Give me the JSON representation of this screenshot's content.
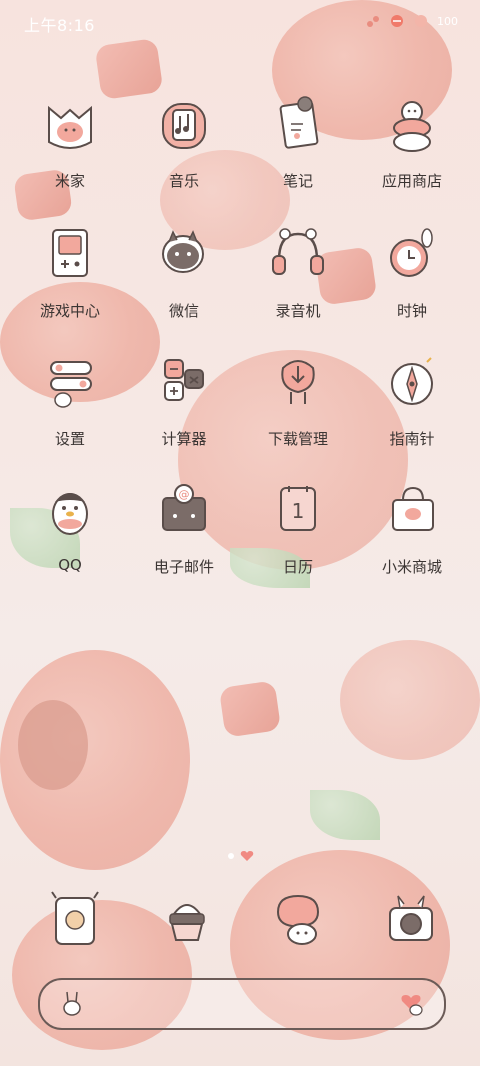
{
  "status_bar": {
    "time": "上午8:16",
    "battery_text": "100"
  },
  "apps": [
    {
      "label": "米家",
      "icon": "mijia-icon"
    },
    {
      "label": "音乐",
      "icon": "music-icon"
    },
    {
      "label": "笔记",
      "icon": "notes-icon"
    },
    {
      "label": "应用商店",
      "icon": "app-store-icon"
    },
    {
      "label": "游戏中心",
      "icon": "game-center-icon"
    },
    {
      "label": "微信",
      "icon": "wechat-icon"
    },
    {
      "label": "录音机",
      "icon": "recorder-icon"
    },
    {
      "label": "时钟",
      "icon": "clock-icon"
    },
    {
      "label": "设置",
      "icon": "settings-icon"
    },
    {
      "label": "计算器",
      "icon": "calculator-icon"
    },
    {
      "label": "下载管理",
      "icon": "download-icon"
    },
    {
      "label": "指南针",
      "icon": "compass-icon"
    },
    {
      "label": "QQ",
      "icon": "qq-penguin-icon"
    },
    {
      "label": "电子邮件",
      "icon": "email-icon"
    },
    {
      "label": "日历",
      "icon": "calendar-icon",
      "day": "1"
    },
    {
      "label": "小米商城",
      "icon": "mi-store-icon"
    }
  ],
  "dock": [
    {
      "icon": "phone-icon"
    },
    {
      "icon": "ice-cream-icon"
    },
    {
      "icon": "messages-icon"
    },
    {
      "icon": "camera-icon"
    }
  ],
  "colors": {
    "accent": "#e9a89b",
    "outline": "#5a4d4a",
    "label": "#3b3533"
  }
}
